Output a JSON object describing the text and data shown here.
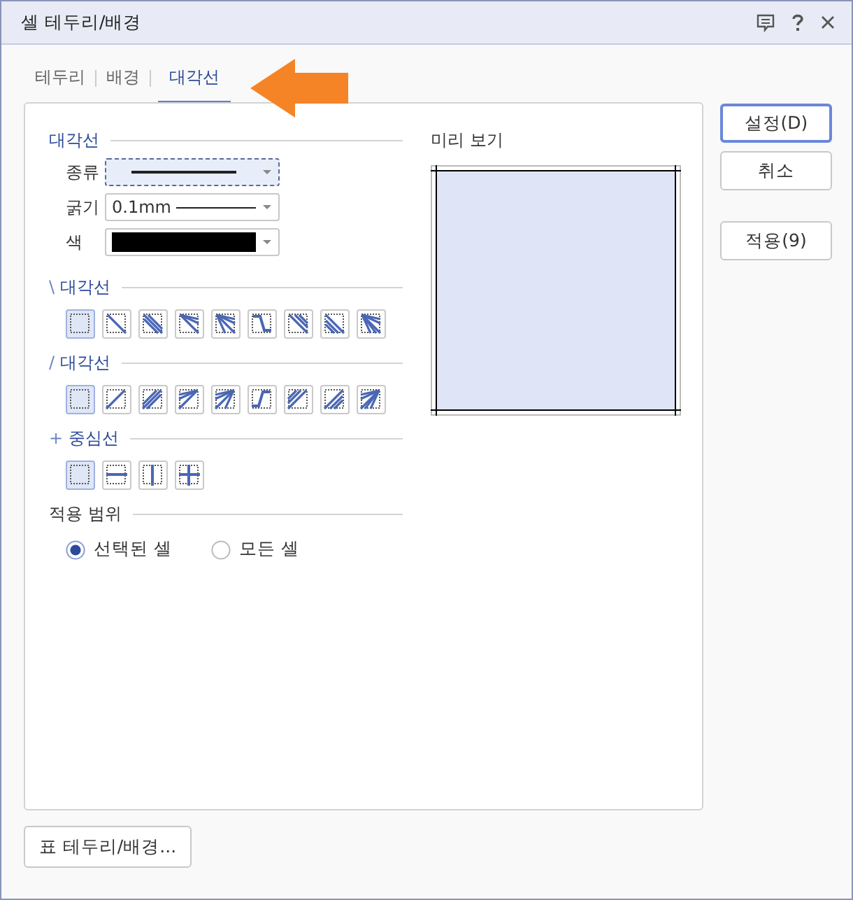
{
  "window": {
    "title": "셀 테두리/배경"
  },
  "tabs": [
    {
      "label": "테두리",
      "selected": false
    },
    {
      "label": "배경",
      "selected": false
    },
    {
      "label": "대각선",
      "selected": true
    }
  ],
  "line_section": {
    "title": "대각선",
    "fields": [
      {
        "label": "종류",
        "kind": "line-type",
        "focused": true
      },
      {
        "label": "굵기",
        "kind": "thickness",
        "value": "0.1mm",
        "focused": false
      },
      {
        "label": "색",
        "kind": "color",
        "color": "#000000",
        "focused": false
      }
    ]
  },
  "backslash_diagonal": {
    "symbol": "\\",
    "title": "대각선",
    "options": [
      {
        "selected": true
      },
      {
        "selected": false
      },
      {
        "selected": false
      },
      {
        "selected": false
      },
      {
        "selected": false
      },
      {
        "selected": false
      },
      {
        "selected": false
      },
      {
        "selected": false
      },
      {
        "selected": false
      }
    ]
  },
  "slash_diagonal": {
    "symbol": "/",
    "title": "대각선",
    "options": [
      {
        "selected": true
      },
      {
        "selected": false
      },
      {
        "selected": false
      },
      {
        "selected": false
      },
      {
        "selected": false
      },
      {
        "selected": false
      },
      {
        "selected": false
      },
      {
        "selected": false
      },
      {
        "selected": false
      }
    ]
  },
  "center_line": {
    "symbol": "+",
    "title": "중심선",
    "options": [
      {
        "selected": true
      },
      {
        "selected": false
      },
      {
        "selected": false
      },
      {
        "selected": false
      }
    ]
  },
  "apply_scope": {
    "title": "적용 범위",
    "options": [
      {
        "label": "선택된 셀",
        "selected": true
      },
      {
        "label": "모든 셀",
        "selected": false
      }
    ]
  },
  "preview": {
    "title": "미리 보기"
  },
  "buttons": [
    {
      "label": "설정(D)",
      "default": true
    },
    {
      "label": "취소",
      "default": false
    },
    {
      "label": "적용(9)",
      "default": false
    }
  ],
  "footer_button": "표 테두리/배경..."
}
